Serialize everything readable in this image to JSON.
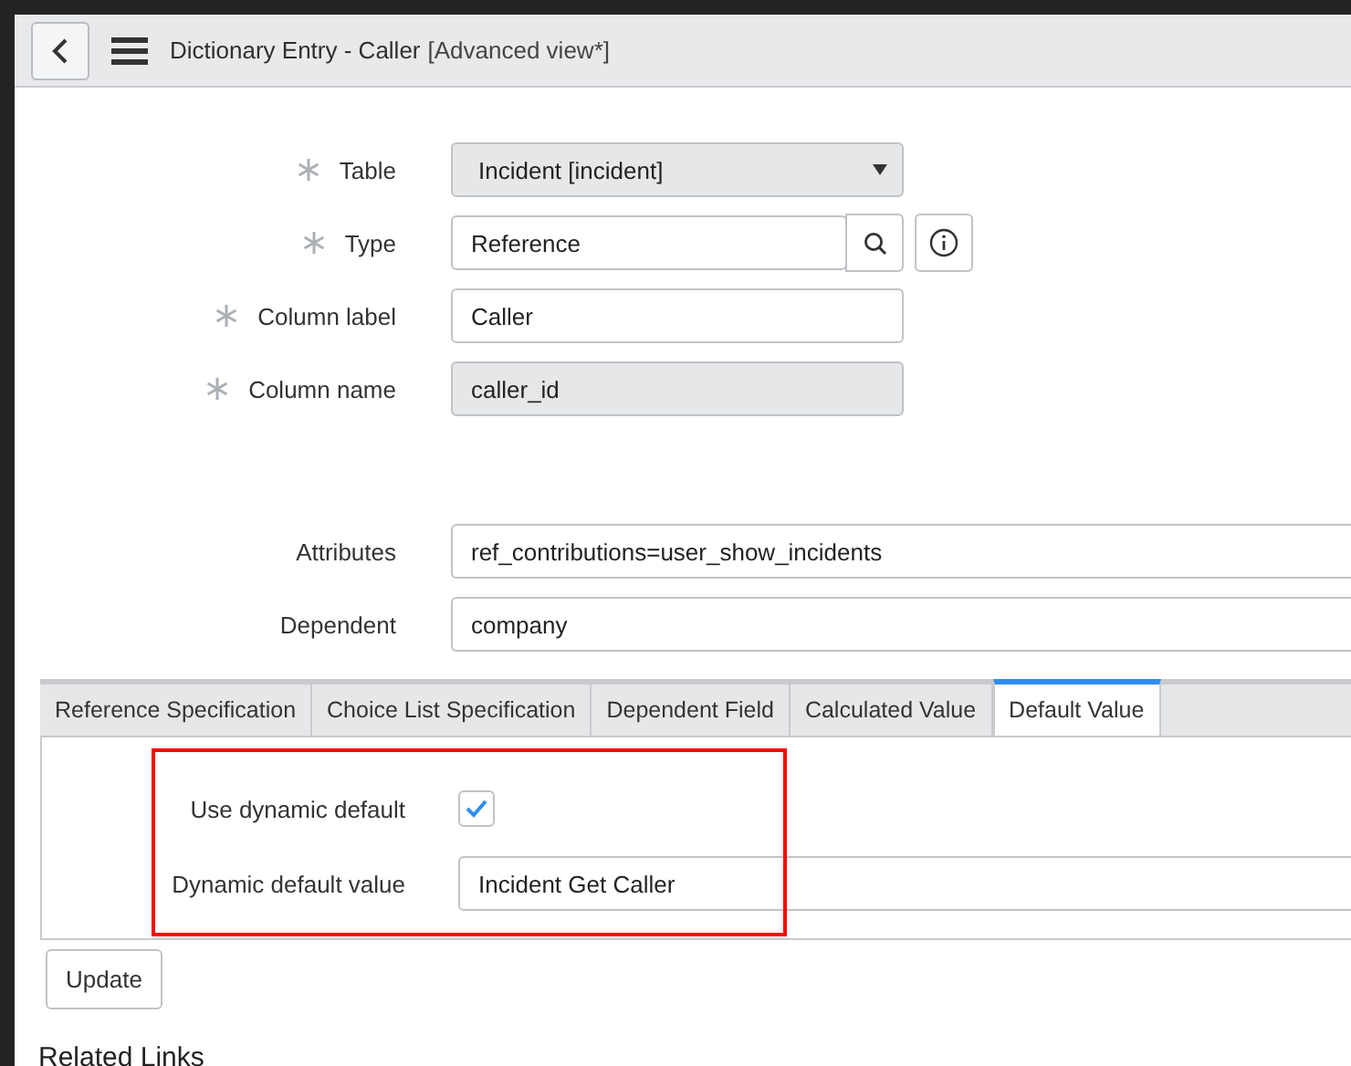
{
  "header": {
    "title": "Dictionary Entry - Caller",
    "view": "[Advanced view*]"
  },
  "fields": [
    {
      "kind": "select",
      "label": "Table",
      "value": "Incident [incident]",
      "required": true,
      "readonly": true
    },
    {
      "kind": "reference",
      "label": "Type",
      "value": "Reference",
      "required": true,
      "readonly": false
    },
    {
      "kind": "text",
      "label": "Column label",
      "value": "Caller",
      "required": true,
      "readonly": false
    },
    {
      "kind": "text",
      "label": "Column name",
      "value": "caller_id",
      "required": true,
      "readonly": true
    }
  ],
  "extra_fields": [
    {
      "label": "Attributes",
      "value": "ref_contributions=user_show_incidents"
    },
    {
      "label": "Dependent",
      "value": "company"
    }
  ],
  "tabs": [
    {
      "label": "Reference Specification",
      "selected": false
    },
    {
      "label": "Choice List Specification",
      "selected": false
    },
    {
      "label": "Dependent Field",
      "selected": false
    },
    {
      "label": "Calculated Value",
      "selected": false
    },
    {
      "label": "Default Value",
      "selected": true
    }
  ],
  "default_value": {
    "use_dynamic_label": "Use dynamic default",
    "use_dynamic_checked": true,
    "value_label": "Dynamic default value",
    "value": "Incident Get Caller"
  },
  "update_button": "Update",
  "related_links": "Related Links"
}
